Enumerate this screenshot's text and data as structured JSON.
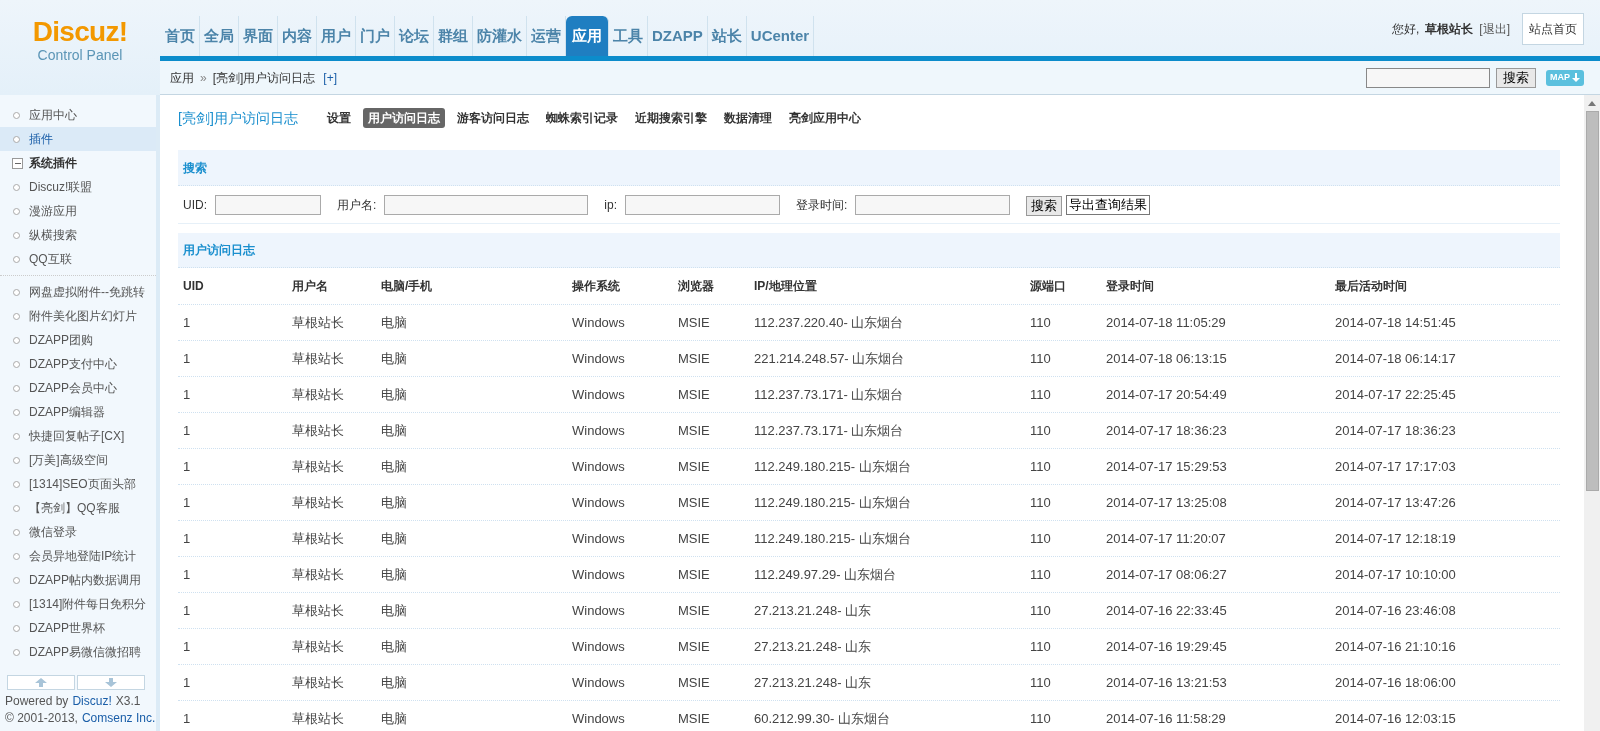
{
  "logo": {
    "title": "Discuz!",
    "subtitle": "Control Panel"
  },
  "nav": [
    {
      "label": "首页",
      "selected": false
    },
    {
      "label": "全局",
      "selected": false
    },
    {
      "label": "界面",
      "selected": false
    },
    {
      "label": "内容",
      "selected": false
    },
    {
      "label": "用户",
      "selected": false
    },
    {
      "label": "门户",
      "selected": false
    },
    {
      "label": "论坛",
      "selected": false
    },
    {
      "label": "群组",
      "selected": false
    },
    {
      "label": "防灌水",
      "selected": false
    },
    {
      "label": "运营",
      "selected": false
    },
    {
      "label": "应用",
      "selected": true
    },
    {
      "label": "工具",
      "selected": false
    },
    {
      "label": "DZAPP",
      "selected": false
    },
    {
      "label": "站长",
      "selected": false
    },
    {
      "label": "UCenter",
      "selected": false
    }
  ],
  "user": {
    "greeting": "您好,",
    "name": "草根站长",
    "logout": "[退出]",
    "home": "站点首页"
  },
  "breadcrumb": {
    "items": [
      "应用",
      "[亮剑]用户访问日志"
    ],
    "separator": "»",
    "add": "[+]"
  },
  "top_search": {
    "button": "搜索",
    "map": "MAP"
  },
  "sidebar": {
    "items": [
      {
        "kind": "link",
        "label": "应用中心",
        "selected": false
      },
      {
        "kind": "link",
        "label": "插件",
        "selected": true
      },
      {
        "kind": "group",
        "label": "系统插件",
        "expanded": true,
        "children": [
          {
            "label": "Discuz!联盟",
            "selected": false
          },
          {
            "label": "漫游应用",
            "selected": false
          },
          {
            "label": "纵横搜索",
            "selected": false
          },
          {
            "label": "QQ互联",
            "selected": false
          }
        ]
      },
      {
        "kind": "link",
        "label": "网盘虚拟附件--免跳转",
        "selected": false
      },
      {
        "kind": "link",
        "label": "附件美化图片幻灯片",
        "selected": false
      },
      {
        "kind": "link",
        "label": "DZAPP团购",
        "selected": false
      },
      {
        "kind": "link",
        "label": "DZAPP支付中心",
        "selected": false
      },
      {
        "kind": "link",
        "label": "DZAPP会员中心",
        "selected": false
      },
      {
        "kind": "link",
        "label": "DZAPP编辑器",
        "selected": false
      },
      {
        "kind": "link",
        "label": "快捷回复帖子[CX]",
        "selected": false
      },
      {
        "kind": "link",
        "label": "[万美]高级空间",
        "selected": false
      },
      {
        "kind": "link",
        "label": "[1314]SEO页面头部",
        "selected": false
      },
      {
        "kind": "link",
        "label": "【亮剑】QQ客服",
        "selected": false
      },
      {
        "kind": "link",
        "label": "微信登录",
        "selected": false
      },
      {
        "kind": "link",
        "label": "会员异地登陆IP统计",
        "selected": false
      },
      {
        "kind": "link",
        "label": "DZAPP帖内数据调用",
        "selected": false
      },
      {
        "kind": "link",
        "label": "[1314]附件每日免积分",
        "selected": false
      },
      {
        "kind": "link",
        "label": "DZAPP世界杯",
        "selected": false
      },
      {
        "kind": "link",
        "label": "DZAPP易微信微招聘",
        "selected": false
      }
    ]
  },
  "footer": {
    "powered": "Powered by",
    "powered_link": "Discuz!",
    "version": "X3.1",
    "copyright": "© 2001-2013,",
    "company": "Comsenz Inc."
  },
  "plugin": {
    "title": "[亮剑]用户访问日志",
    "tabs": [
      {
        "label": "设置",
        "selected": false
      },
      {
        "label": "用户访问日志",
        "selected": true
      },
      {
        "label": "游客访问日志",
        "selected": false
      },
      {
        "label": "蜘蛛索引记录",
        "selected": false
      },
      {
        "label": "近期搜索引擎",
        "selected": false
      },
      {
        "label": "数据清理",
        "selected": false
      },
      {
        "label": "亮剑应用中心",
        "selected": false
      }
    ]
  },
  "search": {
    "title": "搜索",
    "fields": [
      {
        "label": "UID:"
      },
      {
        "label": "用户名:"
      },
      {
        "label": "ip:"
      },
      {
        "label": "登录时间:"
      }
    ],
    "button": "搜索",
    "export": "导出查询结果"
  },
  "table": {
    "title": "用户访问日志",
    "columns": [
      "UID",
      "用户名",
      "电脑/手机",
      "操作系统",
      "浏览器",
      "IP/地理位置",
      "源端口",
      "登录时间",
      "最后活动时间"
    ],
    "rows": [
      [
        "1",
        "草根站长",
        "电脑",
        "Windows",
        "MSIE",
        "112.237.220.40- 山东烟台",
        "110",
        "2014-07-18 11:05:29",
        "2014-07-18 14:51:45"
      ],
      [
        "1",
        "草根站长",
        "电脑",
        "Windows",
        "MSIE",
        "221.214.248.57- 山东烟台",
        "110",
        "2014-07-18 06:13:15",
        "2014-07-18 06:14:17"
      ],
      [
        "1",
        "草根站长",
        "电脑",
        "Windows",
        "MSIE",
        "112.237.73.171- 山东烟台",
        "110",
        "2014-07-17 20:54:49",
        "2014-07-17 22:25:45"
      ],
      [
        "1",
        "草根站长",
        "电脑",
        "Windows",
        "MSIE",
        "112.237.73.171- 山东烟台",
        "110",
        "2014-07-17 18:36:23",
        "2014-07-17 18:36:23"
      ],
      [
        "1",
        "草根站长",
        "电脑",
        "Windows",
        "MSIE",
        "112.249.180.215- 山东烟台",
        "110",
        "2014-07-17 15:29:53",
        "2014-07-17 17:17:03"
      ],
      [
        "1",
        "草根站长",
        "电脑",
        "Windows",
        "MSIE",
        "112.249.180.215- 山东烟台",
        "110",
        "2014-07-17 13:25:08",
        "2014-07-17 13:47:26"
      ],
      [
        "1",
        "草根站长",
        "电脑",
        "Windows",
        "MSIE",
        "112.249.180.215- 山东烟台",
        "110",
        "2014-07-17 11:20:07",
        "2014-07-17 12:18:19"
      ],
      [
        "1",
        "草根站长",
        "电脑",
        "Windows",
        "MSIE",
        "112.249.97.29- 山东烟台",
        "110",
        "2014-07-17 08:06:27",
        "2014-07-17 10:10:00"
      ],
      [
        "1",
        "草根站长",
        "电脑",
        "Windows",
        "MSIE",
        "27.213.21.248- 山东",
        "110",
        "2014-07-16 22:33:45",
        "2014-07-16 23:46:08"
      ],
      [
        "1",
        "草根站长",
        "电脑",
        "Windows",
        "MSIE",
        "27.213.21.248- 山东",
        "110",
        "2014-07-16 19:29:45",
        "2014-07-16 21:10:16"
      ],
      [
        "1",
        "草根站长",
        "电脑",
        "Windows",
        "MSIE",
        "27.213.21.248- 山东",
        "110",
        "2014-07-16 13:21:53",
        "2014-07-16 18:06:00"
      ],
      [
        "1",
        "草根站长",
        "电脑",
        "Windows",
        "MSIE",
        "60.212.99.30- 山东烟台",
        "110",
        "2014-07-16 11:58:29",
        "2014-07-16 12:03:15"
      ]
    ]
  }
}
